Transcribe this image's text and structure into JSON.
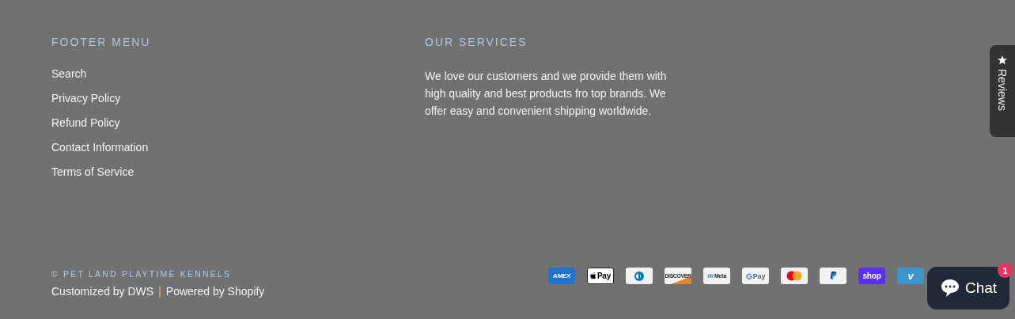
{
  "footer_menu": {
    "title": "FOOTER MENU",
    "links": [
      "Search",
      "Privacy Policy",
      "Refund Policy",
      "Contact Information",
      "Terms of Service"
    ]
  },
  "our_services": {
    "title": "OUR SERVICES",
    "text": "We love our customers and we provide them with high quality and best products fro top brands. We offer easy and convenient shipping worldwide."
  },
  "copyright": "© PET LAND PLAYTIME KENNELS",
  "credits": {
    "customized": "Customized by DWS",
    "separator": "|",
    "powered": "Powered by Shopify"
  },
  "payments": [
    {
      "kind": "amex",
      "label": "AMEX"
    },
    {
      "kind": "applepay",
      "label": "Pay"
    },
    {
      "kind": "diners"
    },
    {
      "kind": "discover",
      "label": "DISCOVER"
    },
    {
      "kind": "meta",
      "label": "Meta"
    },
    {
      "kind": "gpay",
      "label": "Pay"
    },
    {
      "kind": "mastercard"
    },
    {
      "kind": "paypal"
    },
    {
      "kind": "shop",
      "label": "shop"
    },
    {
      "kind": "venmo",
      "label": "v"
    }
  ],
  "reviews_tab": {
    "label": "Reviews"
  },
  "chat_button": {
    "label": "Chat",
    "badge": "1"
  }
}
